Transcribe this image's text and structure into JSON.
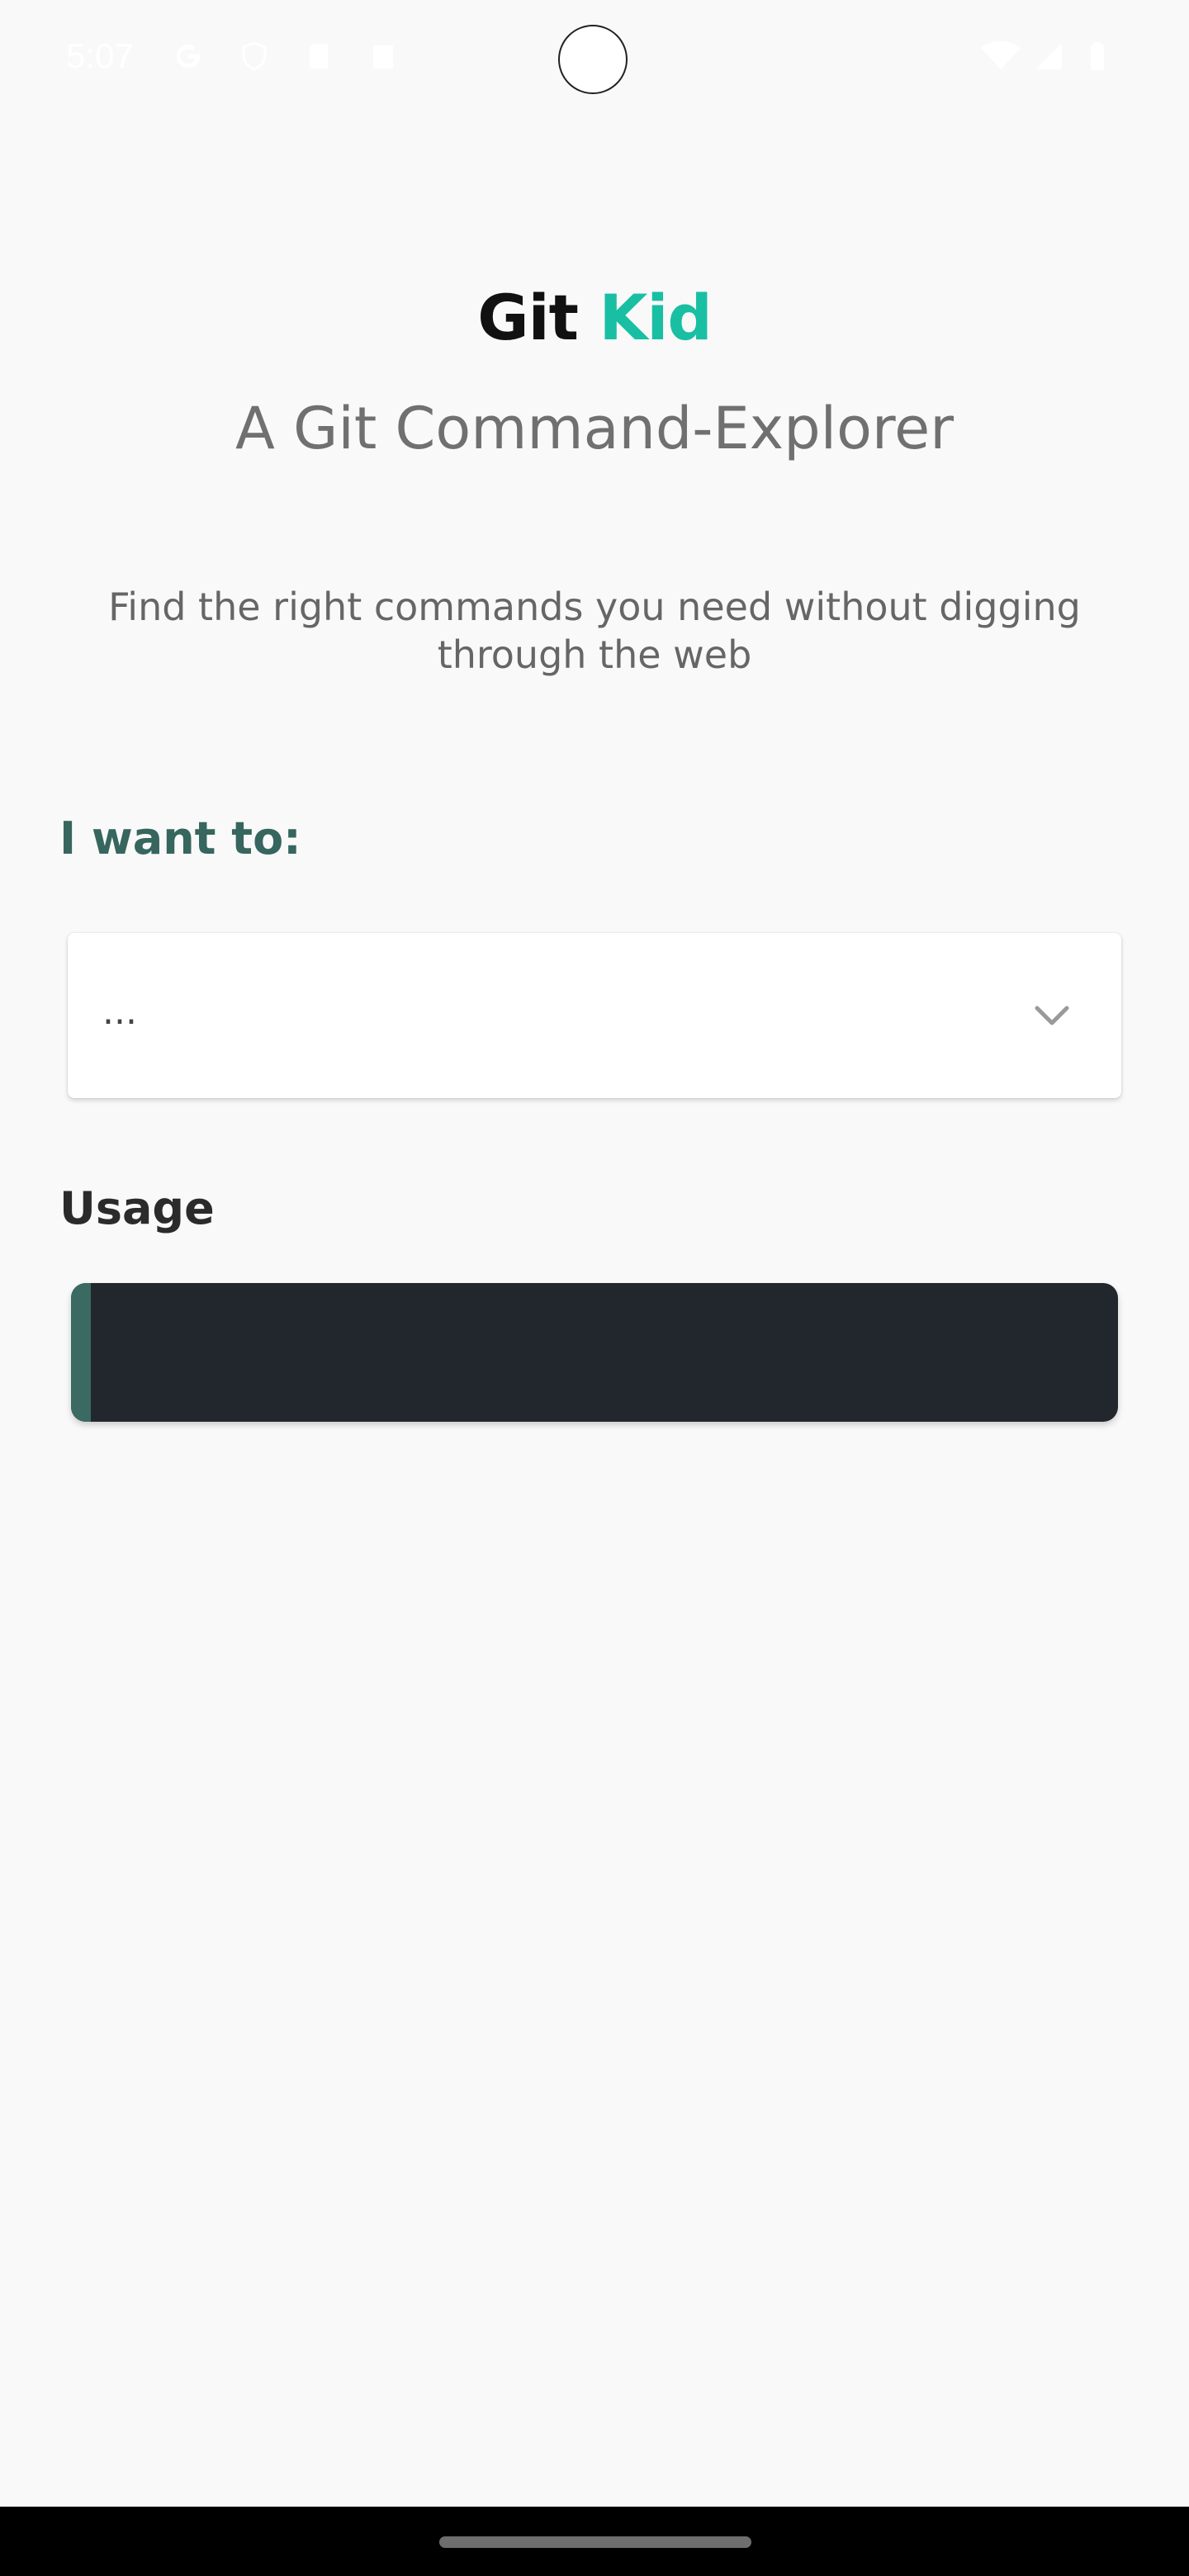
{
  "status_bar": {
    "time": "5:07",
    "left_icons": [
      "google-icon",
      "shield-icon",
      "sd-card-icon",
      "clipboard-icon"
    ],
    "right_icons": [
      "wifi-icon",
      "cell-signal-icon",
      "battery-icon"
    ]
  },
  "header": {
    "title_part1": "Git",
    "title_part2": "Kid",
    "accent_color": "#19bfa3",
    "subtitle": "A Git Command-Explorer"
  },
  "intro": {
    "description": "Find the right commands you need without digging through the web"
  },
  "form": {
    "want_label": "I want to:",
    "select_value": "...",
    "label_color": "#36665e"
  },
  "usage": {
    "label": "Usage",
    "code": ""
  }
}
